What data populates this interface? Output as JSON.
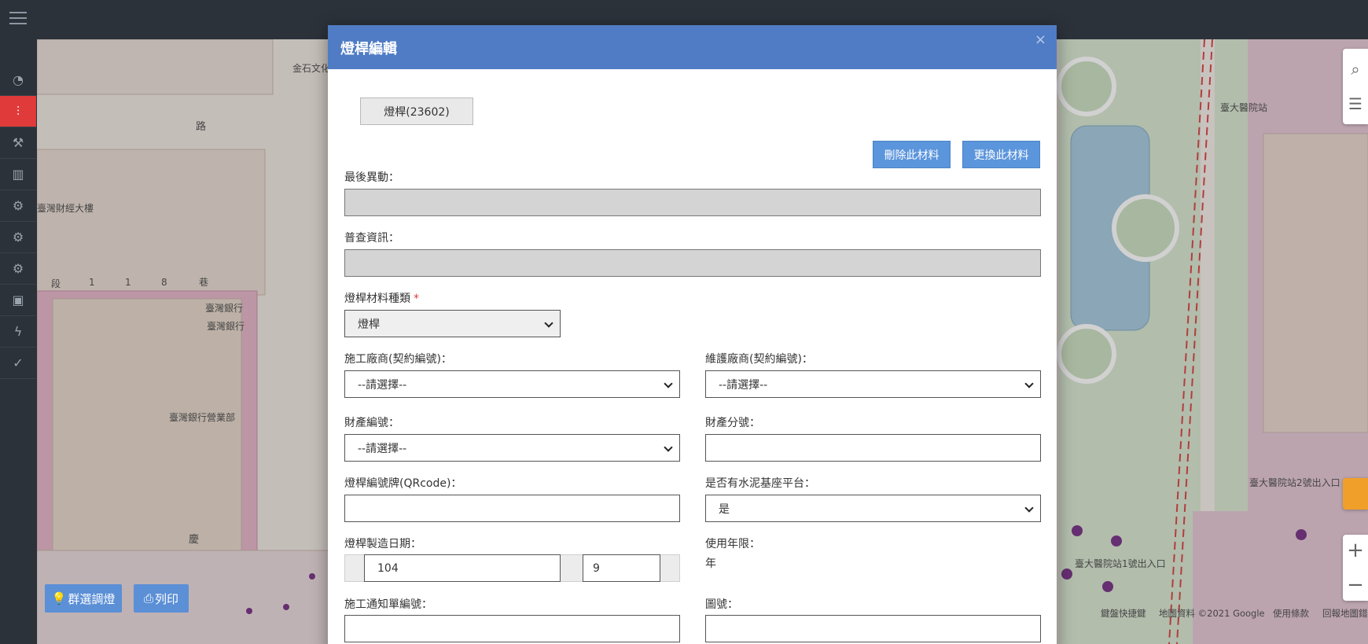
{
  "modal": {
    "title": "燈桿編輯",
    "close": "×",
    "tab_label": "燈桿(23602)",
    "delete_btn": "刪除此材料",
    "replace_btn": "更換此材料",
    "fields": {
      "last_change": {
        "label": "最後異動：",
        "value": ""
      },
      "survey_info": {
        "label": "普查資訊：",
        "value": ""
      },
      "material_type": {
        "label": "燈桿材料種類",
        "required": "*",
        "value": "燈桿"
      },
      "contractor": {
        "label": "施工廠商(契約編號)：",
        "value": "--請選擇--"
      },
      "maintainer": {
        "label": "維護廠商(契約編號)：",
        "value": "--請選擇--"
      },
      "asset_no": {
        "label": "財產編號：",
        "value": "--請選擇--"
      },
      "asset_sub_no": {
        "label": "財產分號：",
        "value": ""
      },
      "qrcode": {
        "label": "燈桿編號牌(QRcode)：",
        "value": ""
      },
      "cement_base": {
        "label": "是否有水泥基座平台：",
        "value": "是"
      },
      "mfg_date": {
        "label": "燈桿製造日期：",
        "year": "104",
        "month": "9"
      },
      "service_life": {
        "label": "使用年限：",
        "value": "年"
      },
      "notice_no": {
        "label": "施工通知單編號：",
        "value": ""
      },
      "drawing_no": {
        "label": "圖號：",
        "value": ""
      }
    }
  },
  "map": {
    "group_btn": "群選調燈",
    "print_btn": "列印",
    "footer": {
      "shortcuts": "鍵盤快捷鍵",
      "copyright": "地圖資料 ©2021 Google",
      "terms": "使用條款",
      "report": "回報地圖錯誤"
    },
    "labels": [
      "臺灣銀行",
      "臺灣銀行",
      "臺灣銀行營業部",
      "臺大醫院站",
      "臺大醫院站2號出入口",
      "臺大醫院站1號出入口",
      "金石文化",
      "臺灣財經大樓",
      "路",
      "慶",
      "段",
      "1",
      "1",
      "8",
      "巷"
    ]
  },
  "sidebar": {
    "icons": [
      "dashboard-icon",
      "sliders-icon",
      "wrench-icon",
      "chart-icon",
      "cogs-icon",
      "cogs-icon",
      "gear-icon",
      "archive-icon",
      "bolt-icon",
      "check-circle-icon"
    ]
  }
}
